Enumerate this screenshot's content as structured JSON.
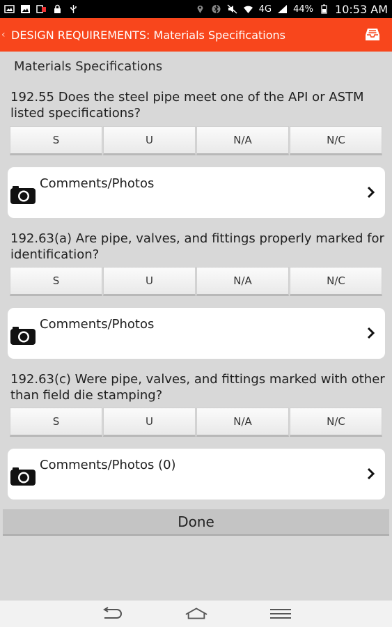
{
  "status_bar": {
    "network_label": "4G",
    "battery_text": "44%",
    "time": "10:53 AM"
  },
  "action_bar": {
    "back_icon": "chevron-left-icon",
    "title": "DESIGN REQUIREMENTS: Materials Specifications",
    "action_icon": "inbox-tray-icon"
  },
  "section_title": "Materials Specifications",
  "answer_options": [
    "S",
    "U",
    "N/A",
    "N/C"
  ],
  "questions": [
    {
      "text": "192.55 Does the steel pipe meet one of the API or ASTM listed specifications?",
      "comments_label": "Comments/Photos"
    },
    {
      "text": "192.63(a) Are pipe, valves, and fittings properly marked for identification?",
      "comments_label": "Comments/Photos"
    },
    {
      "text": "192.63(c) Were pipe, valves, and fittings marked with other than field die stamping?",
      "comments_label": "Comments/Photos (0)"
    }
  ],
  "done_label": "Done",
  "colors": {
    "accent": "#f8461c",
    "background": "#d8d8d8",
    "card": "#ffffff"
  }
}
